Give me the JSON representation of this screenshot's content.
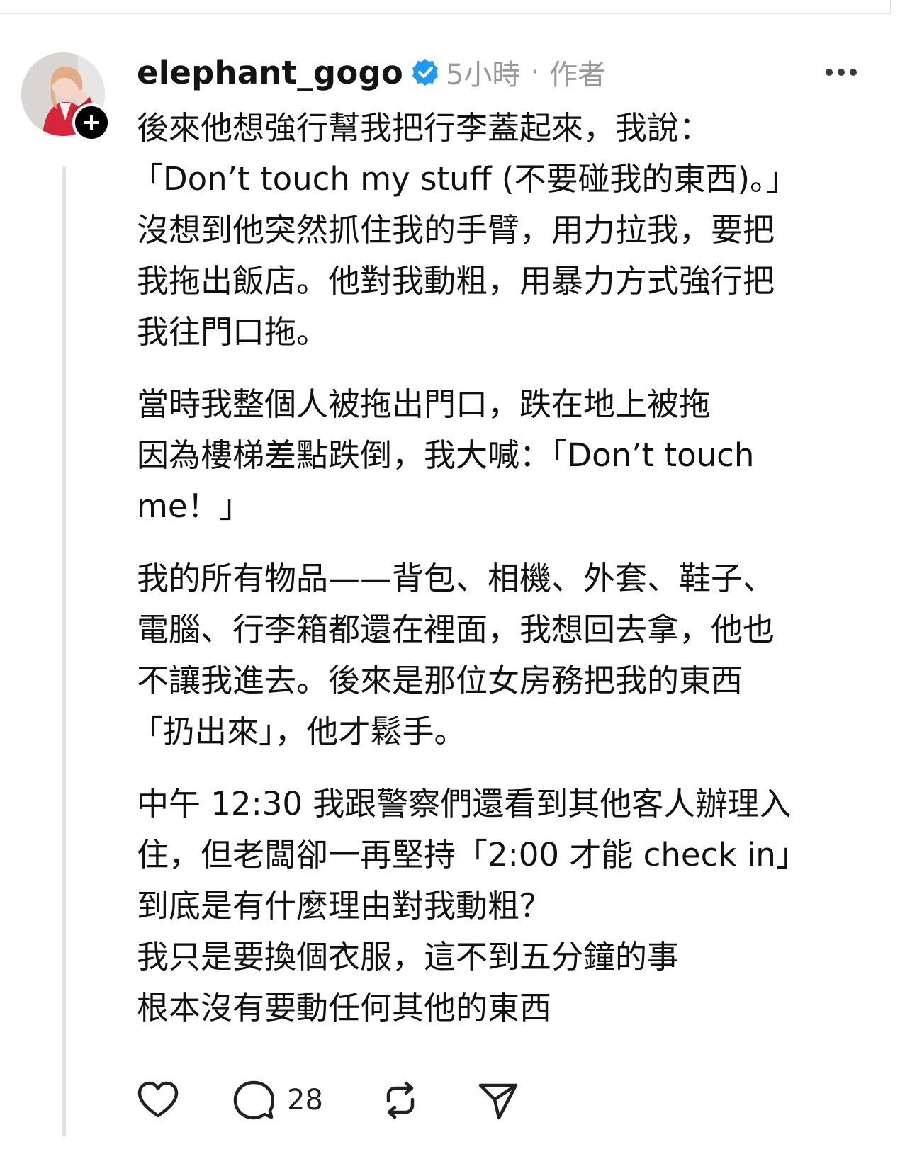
{
  "post": {
    "author": {
      "username": "elephant_gogo",
      "verified": true,
      "time": "5小時",
      "separator": "·",
      "role": "作者"
    },
    "paragraphs": [
      [
        "後來他想強行幫我把行李蓋起來，我說：",
        "「Don’t touch my stuff (不要碰我的東西)。」",
        "沒想到他突然抓住我的手臂，用力拉我，要把",
        "我拖出飯店。他對我動粗，用暴力方式強行把",
        "我往門口拖。"
      ],
      [
        "當時我整個人被拖出門口，跌在地上被拖",
        "因為樓梯差點跌倒，我大喊：「Don’t touch",
        "me！」"
      ],
      [
        "我的所有物品——背包、相機、外套、鞋子、",
        "電腦、行李箱都還在裡面，我想回去拿，他也",
        "不讓我進去。後來是那位女房務把我的東西",
        "「扔出來」，他才鬆手。"
      ],
      [
        "中午 12:30 我跟警察們還看到其他客人辦理入",
        "住，但老闆卻一再堅持「2:00 才能 check in」",
        "到底是有什麼理由對我動粗？",
        "我只是要換個衣服，這不到五分鐘的事",
        "根本沒有要動任何其他的東西"
      ]
    ],
    "actions": {
      "like_icon": "heart-icon",
      "reply_icon": "speech-bubble-icon",
      "reply_count": "28",
      "repost_icon": "repost-icon",
      "share_icon": "paper-plane-icon"
    }
  },
  "colors": {
    "verified_badge": "#1d9bf0",
    "meta_text": "#9a9a9a",
    "thread_line": "#e2e2e2"
  }
}
